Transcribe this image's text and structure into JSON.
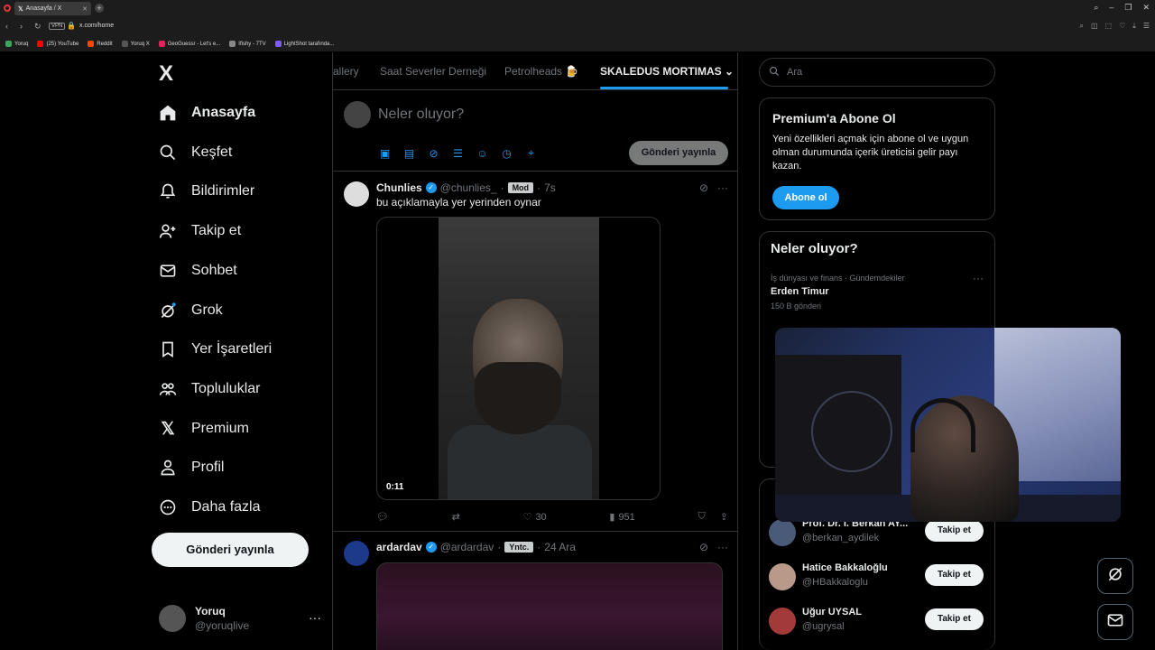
{
  "browser": {
    "tab_title": "Anasayfa / X",
    "url": "x.com/home",
    "vpn_label": "VPN",
    "bookmarks": [
      {
        "label": "Yoruq",
        "color": "#3ba55c"
      },
      {
        "label": "(25) YouTube",
        "color": "#ff0000"
      },
      {
        "label": "Reddit",
        "color": "#ff4500"
      },
      {
        "label": "Yoruq X",
        "color": "#555555"
      },
      {
        "label": "GeoGuessr - Let's e...",
        "color": "#e0245e"
      },
      {
        "label": "Ifishy - 7TV",
        "color": "#888888"
      },
      {
        "label": "LightShot tarafında...",
        "color": "#7c5cff"
      }
    ]
  },
  "sidebar": {
    "logo": "X",
    "items": [
      {
        "label": "Anasayfa",
        "icon": "home-icon"
      },
      {
        "label": "Keşfet",
        "icon": "search-icon"
      },
      {
        "label": "Bildirimler",
        "icon": "bell-icon"
      },
      {
        "label": "Takip et",
        "icon": "add-user-icon"
      },
      {
        "label": "Sohbet",
        "icon": "mail-icon"
      },
      {
        "label": "Grok",
        "icon": "grok-icon"
      },
      {
        "label": "Yer İşaretleri",
        "icon": "bookmark-icon"
      },
      {
        "label": "Topluluklar",
        "icon": "communities-icon"
      },
      {
        "label": "Premium",
        "icon": "x-icon"
      },
      {
        "label": "Profil",
        "icon": "profile-icon"
      },
      {
        "label": "Daha fazla",
        "icon": "more-icon"
      }
    ],
    "post_button": "Gönderi yayınla",
    "account": {
      "name": "Yoruq",
      "handle": "@yoruqlive"
    }
  },
  "main": {
    "tabs": [
      "allery",
      "Saat Severler Derneği",
      "Petrolheads 🍺",
      "SKALEDUS MORTIMAS"
    ],
    "composer": {
      "placeholder": "Neler oluyor?",
      "post_button": "Gönderi yayınla"
    },
    "tweets": [
      {
        "name": "Chunlies",
        "handle": "@chunlies_",
        "badge": "Mod",
        "time": "7s",
        "text": "bu açıklamayla yer yerinden oynar",
        "video_time": "0:11",
        "likes": "30",
        "views": "951"
      },
      {
        "name": "ardardav",
        "handle": "@ardardav",
        "badge": "Yntc.",
        "time": "24 Ara"
      }
    ]
  },
  "right": {
    "search_placeholder": "Ara",
    "premium": {
      "title": "Premium'a Abone Ol",
      "text": "Yeni özellikleri açmak için abone ol ve uygun olman durumunda içerik üreticisi gelir payı kazan.",
      "button": "Abone ol"
    },
    "trends": {
      "title": "Neler oluyor?",
      "items": [
        {
          "meta": "İş dünyası ve finans · Gündemdekiler",
          "name": "Erden Timur",
          "count": "150 B gönderi"
        }
      ]
    },
    "follow": [
      {
        "name": "Prof. Dr. I. Berkan AY...",
        "handle": "@berkan_aydilek",
        "button": "Takip et"
      },
      {
        "name": "Hatice Bakkaloğlu",
        "handle": "@HBakkaloglu",
        "button": "Takip et"
      },
      {
        "name": "Uğur UYSAL",
        "handle": "@ugrysal",
        "button": "Takip et"
      }
    ]
  },
  "colors": {
    "accent": "#1d9bf0",
    "background": "#000000",
    "text": "#e7e9ea",
    "muted": "#71767b"
  }
}
